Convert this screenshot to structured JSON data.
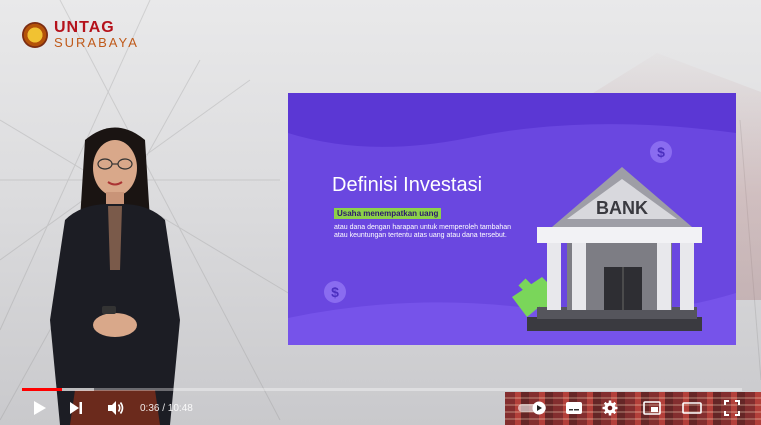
{
  "logo": {
    "top": "UNTAG",
    "bottom": "SURABAYA"
  },
  "slide": {
    "title": "Definisi Investasi",
    "highlight": "Usaha menempatkan uang",
    "body": "atau dana dengan harapan untuk memperoleh tambahan atau keuntungan tertentu atas uang atau dana tersebut.",
    "bank_label": "BANK",
    "coin_symbol": "$"
  },
  "player": {
    "time": "0:36 / 10:48",
    "progress_fraction": 0.056,
    "buffer_fraction": 0.1,
    "accent": "#ff0000",
    "icons": {
      "play": "play-icon",
      "next": "next-icon",
      "volume": "volume-icon",
      "autoplay": "autoplay-toggle-icon",
      "captions": "captions-icon",
      "settings": "gear-icon",
      "miniplayer": "miniplayer-icon",
      "theater": "theater-icon",
      "fullscreen": "fullscreen-icon"
    }
  }
}
